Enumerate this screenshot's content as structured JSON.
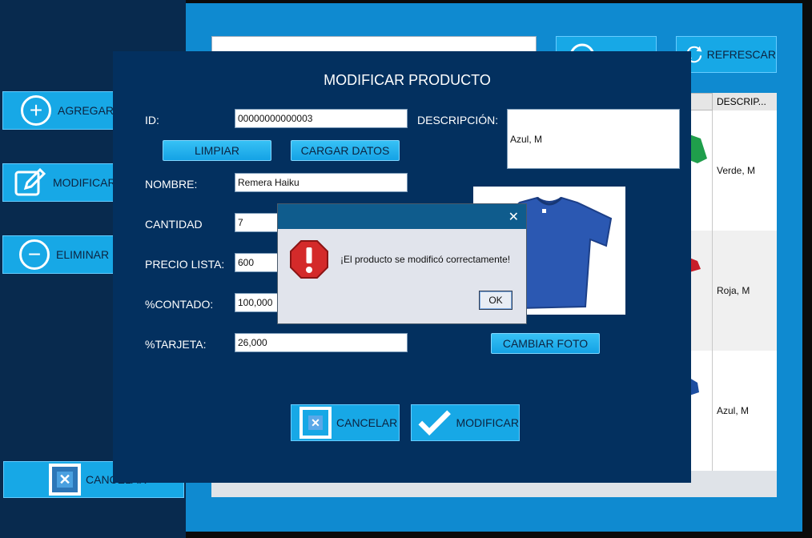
{
  "background_app": {
    "sidebar": [
      {
        "label": "AGREGAR P",
        "icon": "plus-circle-icon"
      },
      {
        "label": "MODIFICAR",
        "icon": "edit-icon"
      },
      {
        "label": "ELIMINAR P",
        "icon": "minus-circle-icon"
      }
    ],
    "cancel_label": "CANCELAR",
    "refresh_label": "REFRESCAR",
    "table_header_desc": "DESCRIP...",
    "rows": [
      {
        "desc": "Verde, M"
      },
      {
        "desc": "Roja, M"
      },
      {
        "desc": "Azul, M"
      }
    ]
  },
  "modal": {
    "title": "MODIFICAR PRODUCTO",
    "id_label": "ID:",
    "id_value": "00000000000003",
    "limpiar": "LIMPIAR",
    "cargar": "CARGAR DATOS",
    "descripcion_label": "DESCRIPCIÓN:",
    "descripcion_value": "Azul, M",
    "nombre_label": "NOMBRE:",
    "nombre_value": "Remera Haiku",
    "cantidad_label": "CANTIDAD",
    "cantidad_value": "7",
    "precio_label": "PRECIO LISTA:",
    "precio_value": "600",
    "contado_label": "%CONTADO:",
    "contado_value": "100,000",
    "tarjeta_label": "%TARJETA:",
    "tarjeta_value": "26,000",
    "cambiar_foto": "CAMBIAR FOTO",
    "cancelar": "CANCELAR",
    "modificar": "MODIFICAR"
  },
  "dialog": {
    "message": "¡El producto se modificó correctamente!",
    "ok": "OK",
    "close": "✕"
  },
  "colors": {
    "modal_bg": "#03305f",
    "button_blue": "#17a8e6",
    "dialog_bar": "#0f5c8d",
    "error_red": "#d42a2a"
  }
}
